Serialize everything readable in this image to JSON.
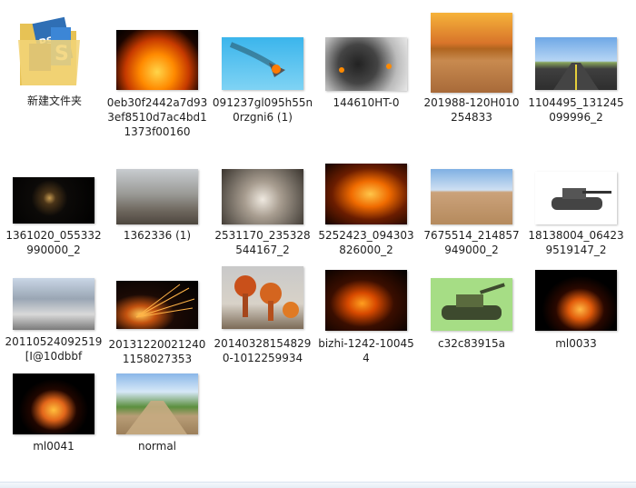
{
  "items": [
    {
      "label": "新建文件夹",
      "type": "folder",
      "icon": "folder-icon"
    },
    {
      "label": "0eb30f2442a7d933ef8510d7ac4bd11373f00160",
      "type": "image",
      "icon": "fire-thumbnail"
    },
    {
      "label": "091237gl095h55n0rzgni6 (1)",
      "type": "image",
      "icon": "jet-thumbnail"
    },
    {
      "label": "144610HT-0",
      "type": "image",
      "icon": "smoke-thumbnail"
    },
    {
      "label": "201988-120H010254833",
      "type": "image",
      "icon": "desert-sunset-thumbnail"
    },
    {
      "label": "1104495_131245099996_2",
      "type": "image",
      "icon": "road-thumbnail"
    },
    {
      "label": "1361020_055332990000_2",
      "type": "image",
      "icon": "explosion-thumbnail"
    },
    {
      "label": "1362336 (1)",
      "type": "image",
      "icon": "ruins-thumbnail"
    },
    {
      "label": "2531170_235328544167_2",
      "type": "image",
      "icon": "rubble-explosion-thumbnail"
    },
    {
      "label": "5252423_094303826000_2",
      "type": "image",
      "icon": "fire-thumbnail"
    },
    {
      "label": "7675514_214857949000_2",
      "type": "image",
      "icon": "desert-plain-thumbnail"
    },
    {
      "label": "18138004_064239519147_2",
      "type": "image",
      "icon": "tank-thumbnail"
    },
    {
      "label": "20110524092519[I@10dbbf",
      "type": "image",
      "icon": "wrecked-car-thumbnail"
    },
    {
      "label": "201312200212401158027353",
      "type": "image",
      "icon": "sparks-thumbnail"
    },
    {
      "label": "201403281548290-1012259934",
      "type": "image",
      "icon": "mushroom-cloud-thumbnail"
    },
    {
      "label": "bizhi-1242-100454",
      "type": "image",
      "icon": "fire-thumbnail"
    },
    {
      "label": "c32c83915a",
      "type": "image",
      "icon": "tank-thumbnail"
    },
    {
      "label": "ml0033",
      "type": "image",
      "icon": "fire-thumbnail"
    },
    {
      "label": "ml0041",
      "type": "image",
      "icon": "fire-thumbnail"
    },
    {
      "label": "normal",
      "type": "image",
      "icon": "field-thumbnail"
    }
  ]
}
